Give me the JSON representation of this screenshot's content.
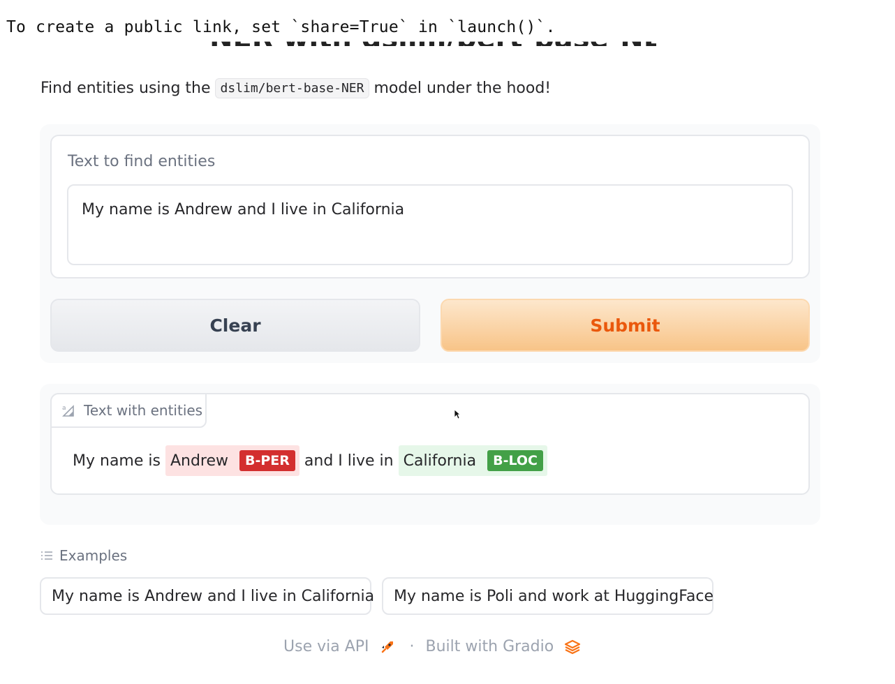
{
  "console": {
    "message": "To create a public link, set `share=True` in `launch()`.",
    "obscured_title": "NER with dslim/bert-base-NER"
  },
  "description": {
    "prefix": "Find entities using the",
    "model_code": "dslim/bert-base-NER",
    "suffix": "model under the hood!"
  },
  "input": {
    "label": "Text to find entities",
    "value": "My name is Andrew and I live in California"
  },
  "buttons": {
    "clear_label": "Clear",
    "submit_label": "Submit"
  },
  "output": {
    "tab_label": "Text with entities",
    "tab_icon": "text-highlight-icon",
    "segments": {
      "text1": "My name is",
      "entity1": "Andrew",
      "tag1": "B-PER",
      "text2": "and I live in",
      "entity2": "California",
      "tag2": "B-LOC"
    },
    "colors": {
      "per_tag": "#d32f2f",
      "per_bg": "#fde2e2",
      "loc_tag": "#43a047",
      "loc_bg": "#e6f7e9"
    }
  },
  "examples": {
    "header": "Examples",
    "items": [
      "My name is Andrew and I live in California",
      "My name is Poli and work at HuggingFace"
    ]
  },
  "footer": {
    "api_label": "Use via API",
    "separator": "·",
    "built_label": "Built with Gradio"
  },
  "accent": {
    "submit": "#ea580c"
  }
}
